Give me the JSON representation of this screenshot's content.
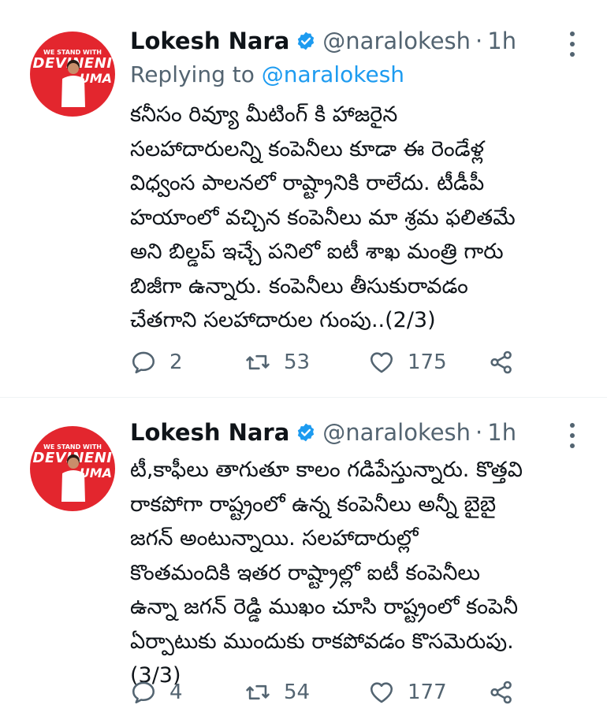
{
  "tweets": [
    {
      "avatar": {
        "banner_top": "WE STAND WITH",
        "banner_name": "DEVINENI",
        "banner_name2": "UMA"
      },
      "author_name": "Lokesh Nara",
      "handle": "@naralokesh",
      "separator": "·",
      "time": "1h",
      "reply_prefix": "Replying to",
      "reply_mention": "@naralokesh",
      "body_lines": [
        "కనీసం రివ్యూ మీటింగ్ కి హాజరైన",
        "సలహాదారులన్ని కంపెనీలు కూడా ఈ రెండేళ్ల",
        "విధ్వంస పాలనలో రాష్ట్రానికి రాలేదు. టీడీపీ",
        "హయాంలో వచ్చిన కంపెనీలు మా శ్రమ ఫలితమే",
        "అని బిల్డప్ ఇచ్చే పనిలో ఐటీ శాఖ మంత్రి గారు",
        "బిజీగా ఉన్నారు. కంపెనీలు తీసుకురావడం",
        "చేతగాని సలహాదారుల గుంపు..(2/3)"
      ],
      "stats": {
        "replies": "2",
        "retweets": "53",
        "likes": "175"
      }
    },
    {
      "avatar": {
        "banner_top": "WE STAND WITH",
        "banner_name": "DEVINENI",
        "banner_name2": "UMA"
      },
      "author_name": "Lokesh Nara",
      "handle": "@naralokesh",
      "separator": "·",
      "time": "1h",
      "body_lines": [
        "టీ,కాఫీలు తాగుతూ కాలం గడిపేస్తున్నారు. కొత్తవి",
        "రాకపోగా రాష్ట్రంలో ఉన్న కంపెనీలు అన్నీ బైబై",
        "జగన్ అంటున్నాయి. సలహాదారుల్లో",
        "కొంతమందికి ఇతర రాష్ట్రాల్లో ఐటీ కంపెనీలు",
        "ఉన్నా జగన్ రెడ్డి ముఖం చూసి రాష్ట్రంలో కంపెనీ",
        "ఏర్పాటుకు ముందుకు రాకపోవడం కొసమెరుపు.",
        "(3/3)"
      ],
      "stats": {
        "replies": "4",
        "retweets": "54",
        "likes": "177"
      }
    }
  ],
  "icons": {
    "verified": "verified-badge-icon",
    "more": "more-vertical-icon",
    "reply": "reply-icon",
    "retweet": "retweet-icon",
    "like": "heart-icon",
    "share": "share-icon"
  },
  "colors": {
    "text": "#0f1419",
    "secondary": "#536471",
    "accent": "#1d9bf0",
    "avatar_bg": "#e3262e"
  }
}
